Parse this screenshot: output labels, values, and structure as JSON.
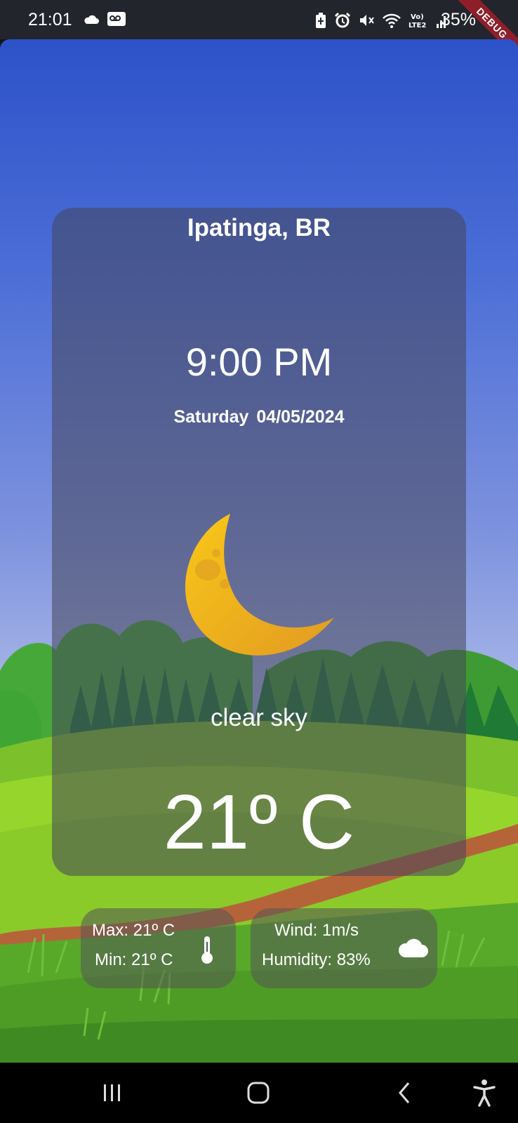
{
  "status_bar": {
    "time": "21:01",
    "left_icons": [
      "cloud-icon",
      "voicemail-icon"
    ],
    "right_icons": [
      "battery-saver-icon",
      "alarm-icon",
      "mute-icon",
      "wifi-icon",
      "volte-lte2-icon",
      "signal-icon"
    ],
    "battery_text": "35%",
    "debug_banner": "DEBUG"
  },
  "weather": {
    "location": "Ipatinga, BR",
    "time": "9:00 PM",
    "date": "Saturday  04/05/2024",
    "icon": "moon-icon",
    "description": "clear sky",
    "temperature": "21º C"
  },
  "details": {
    "max": "Max: 21º C",
    "min": "Min: 21º C",
    "temp_icon": "thermometer-icon",
    "wind": "Wind: 1m/s",
    "humidity": "Humidity: 83%",
    "wind_icon": "cloud-icon"
  },
  "nav_bar": {
    "buttons": [
      "recent-apps-icon",
      "home-icon",
      "back-icon",
      "accessibility-icon"
    ]
  },
  "colors": {
    "sky_top": "#2d52c9",
    "sky_bottom": "#a9b8e6",
    "grass": "#7cc12c",
    "trees": "#2a8a3a",
    "path": "#b5643a",
    "moon": "#f2b824"
  }
}
